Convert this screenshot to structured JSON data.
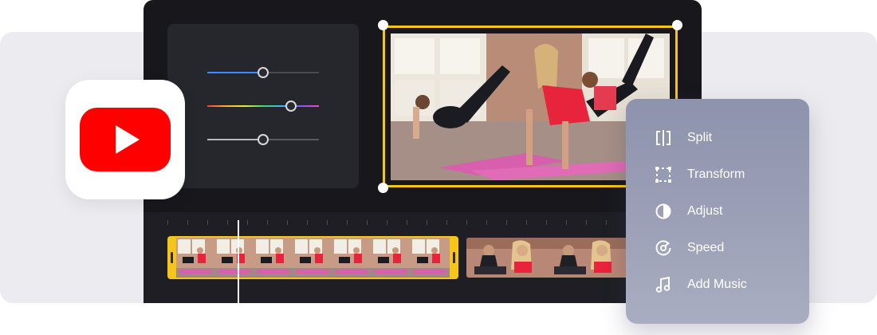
{
  "menu": {
    "items": [
      {
        "label": "Split",
        "icon": "split-icon"
      },
      {
        "label": "Transform",
        "icon": "transform-icon"
      },
      {
        "label": "Adjust",
        "icon": "adjust-icon"
      },
      {
        "label": "Speed",
        "icon": "speed-icon"
      },
      {
        "label": "Add Music",
        "icon": "music-icon"
      }
    ]
  },
  "adjust_sliders": [
    {
      "name": "blue-slider",
      "value": 0.5,
      "color": "#3d8bff"
    },
    {
      "name": "hue-slider",
      "value": 0.75,
      "color": "rainbow"
    },
    {
      "name": "gray-slider",
      "value": 0.5,
      "color": "#9a9aa2"
    }
  ],
  "colors": {
    "accent": "#f5c518",
    "editor_bg": "#17171c",
    "youtube_red": "#ff0000"
  },
  "logo": {
    "name": "YouTube"
  }
}
